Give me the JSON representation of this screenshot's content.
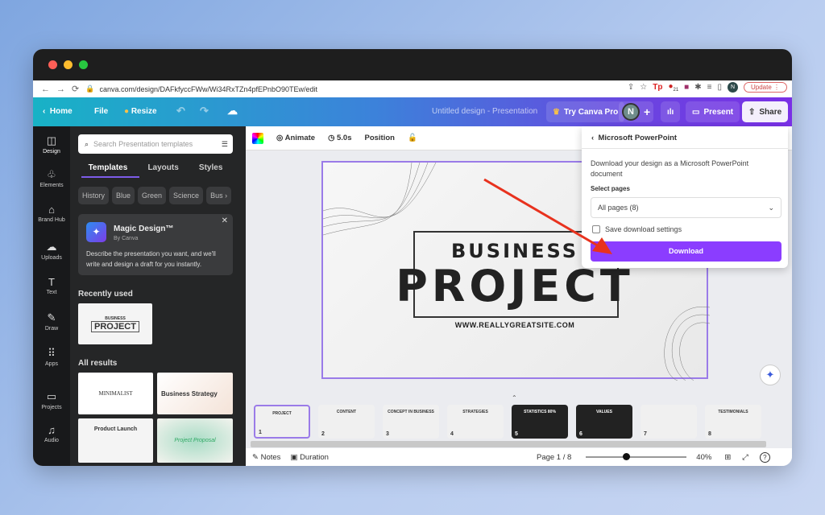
{
  "browser": {
    "url": "canva.com/design/DAFkfyccFWw/Wi34RxTZn4pfEPnbO90TEw/edit",
    "update_label": "Update",
    "profile_initial": "N",
    "ext_badge": "21"
  },
  "header": {
    "home": "Home",
    "file": "File",
    "resize": "Resize",
    "title": "Untitled design - Presentation",
    "try_pro": "Try Canva Pro",
    "avatar": "N",
    "present": "Present",
    "share": "Share"
  },
  "rail": [
    {
      "label": "Design",
      "icon": "◫"
    },
    {
      "label": "Elements",
      "icon": "♧"
    },
    {
      "label": "Brand Hub",
      "icon": "⌂"
    },
    {
      "label": "Uploads",
      "icon": "☁"
    },
    {
      "label": "Text",
      "icon": "T"
    },
    {
      "label": "Draw",
      "icon": "✎"
    },
    {
      "label": "Apps",
      "icon": "⠿"
    },
    {
      "label": "Projects",
      "icon": "▭"
    },
    {
      "label": "Audio",
      "icon": "♫"
    }
  ],
  "panel": {
    "search_placeholder": "Search Presentation templates",
    "tabs": [
      "Templates",
      "Layouts",
      "Styles"
    ],
    "chips": [
      "History",
      "Blue",
      "Green",
      "Science",
      "Bus"
    ],
    "magic": {
      "title": "Magic Design™",
      "by": "By Canva",
      "desc": "Describe the presentation you want, and we'll write and design a draft for you instantly."
    },
    "recent_heading": "Recently used",
    "recent": {
      "line1": "BUSINESS",
      "line2": "PROJECT"
    },
    "all_heading": "All results",
    "results": [
      "MINIMALIST",
      "Business Strategy",
      "Product Launch",
      "Project Proposal"
    ]
  },
  "toolbar": {
    "animate": "Animate",
    "duration": "5.0s",
    "position": "Position"
  },
  "slide": {
    "line1": "BUSINESS",
    "line2": "PROJECT",
    "site": "WWW.REALLYGREATSITE.COM"
  },
  "popup": {
    "title": "Microsoft PowerPoint",
    "desc": "Download your design as a Microsoft PowerPoint document",
    "select_label": "Select pages",
    "select_value": "All pages (8)",
    "checkbox_label": "Save download settings",
    "checkbox_checked": false,
    "download": "Download",
    "accent": "#8b3dff"
  },
  "thumbnails": [
    {
      "n": "1",
      "t": "PROJECT"
    },
    {
      "n": "2",
      "t": "CONTENT"
    },
    {
      "n": "3",
      "t": "CONCEPT IN BUSINESS"
    },
    {
      "n": "4",
      "t": "STRATEGIES"
    },
    {
      "n": "5",
      "t": "STATISTICS 80%"
    },
    {
      "n": "6",
      "t": "VALUES"
    },
    {
      "n": "7",
      "t": ""
    },
    {
      "n": "8",
      "t": "TESTIMONIALS"
    }
  ],
  "footer": {
    "notes": "Notes",
    "duration": "Duration",
    "page": "Page 1 / 8",
    "zoom": "40%",
    "zoom_percent": 40
  }
}
